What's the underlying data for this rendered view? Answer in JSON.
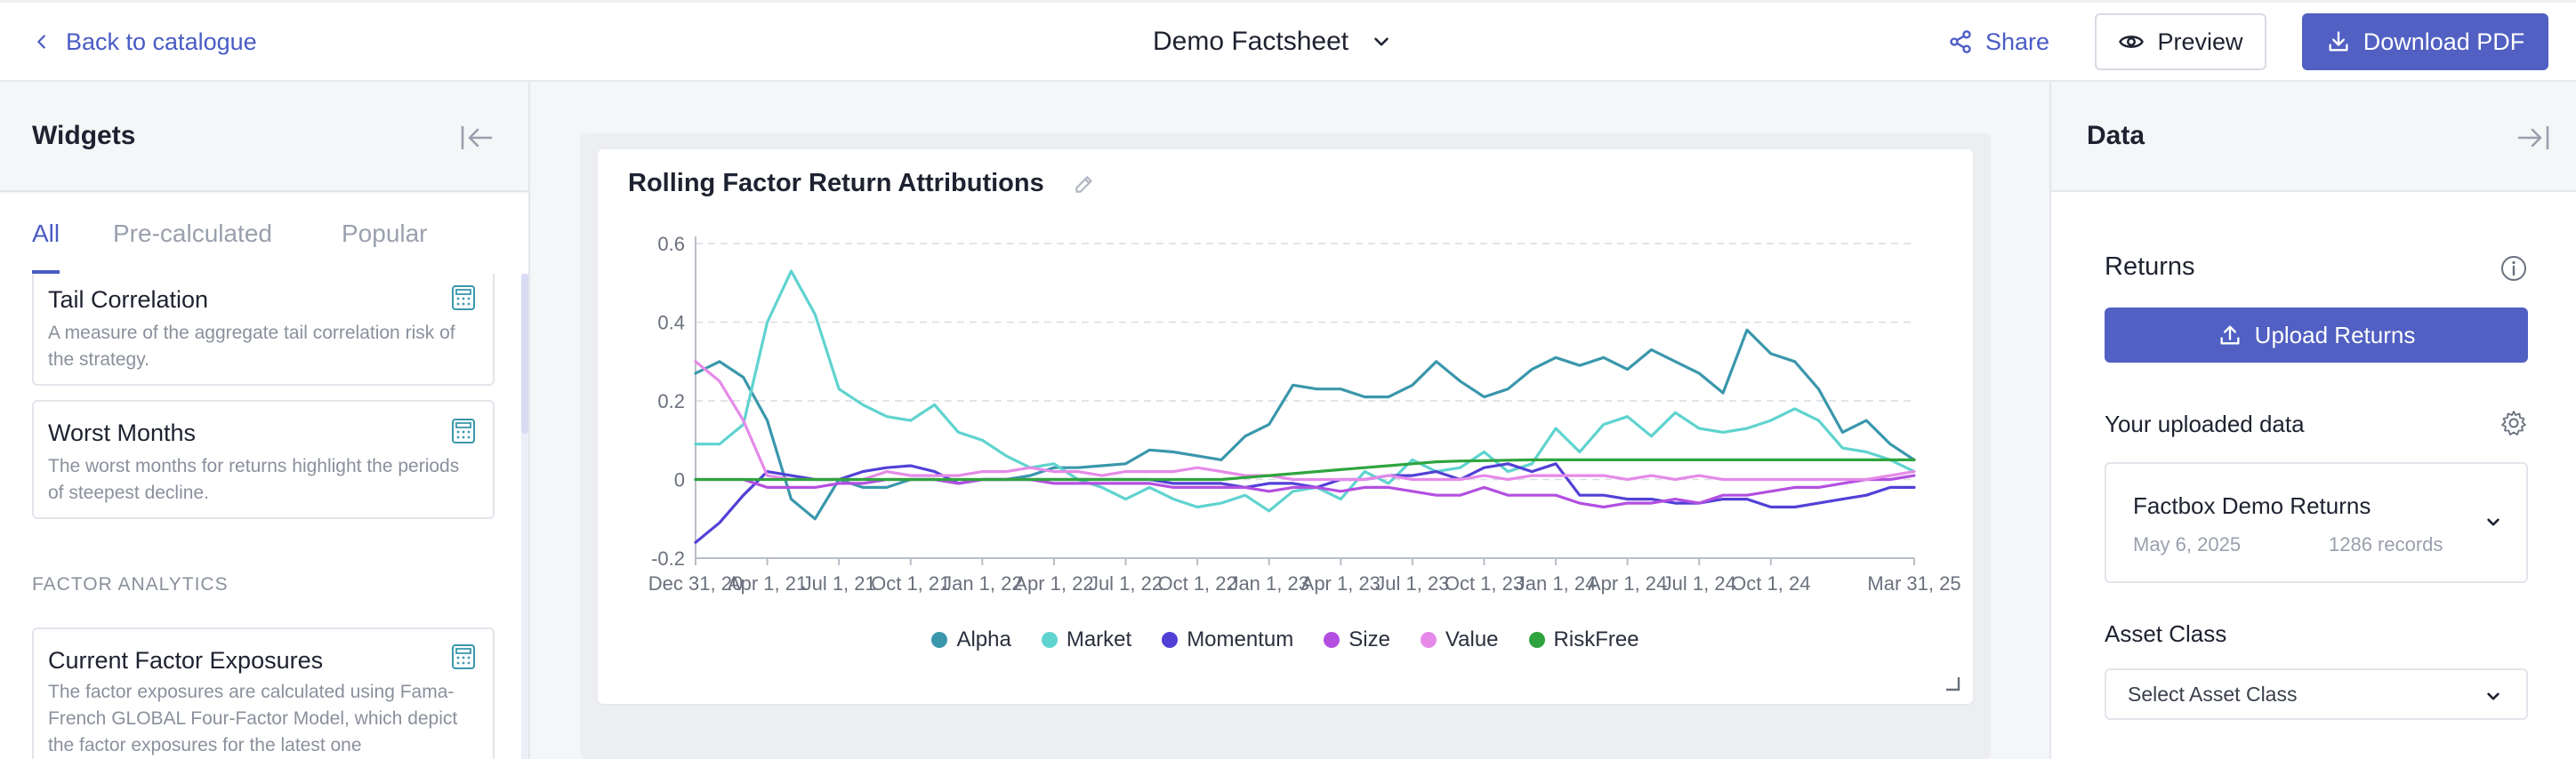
{
  "topbar": {
    "back_label": "Back to catalogue",
    "doc_title": "Demo Factsheet",
    "share_label": "Share",
    "preview_label": "Preview",
    "download_label": "Download PDF"
  },
  "widgets": {
    "title": "Widgets",
    "tabs": [
      {
        "label": "All",
        "active": true
      },
      {
        "label": "Pre-calculated",
        "active": false
      },
      {
        "label": "Popular",
        "active": false
      }
    ],
    "cards": [
      {
        "title": "Tail Correlation",
        "description": "A measure of the aggregate tail correlation risk of the strategy.",
        "icon": "calculator-icon"
      },
      {
        "title": "Worst Months",
        "description": "The worst months for returns highlight the periods of steepest decline.",
        "icon": "calculator-icon"
      }
    ],
    "section_label": "FACTOR ANALYTICS",
    "section_cards": [
      {
        "title": "Current Factor Exposures",
        "description": "The factor exposures are calculated using Fama-French GLOBAL Four-Factor Model, which depict the factor exposures for the latest one",
        "icon": "calculator-icon"
      }
    ]
  },
  "chart_card": {
    "title": "Rolling Factor Return Attributions"
  },
  "chart_data": {
    "type": "line",
    "title": "Rolling Factor Return Attributions",
    "xlabel": "",
    "ylabel": "",
    "ylim": [
      -0.2,
      0.6
    ],
    "yticks": [
      "0.6",
      "0.4",
      "0.2",
      "0",
      "-0.2"
    ],
    "ytick_values": [
      0.6,
      0.4,
      0.2,
      0,
      -0.2
    ],
    "xticks": [
      "Dec 31, 20",
      "Apr 1, 21",
      "Jul 1, 21",
      "Oct 1, 21",
      "Jan 1, 22",
      "Apr 1, 22",
      "Jul 1, 22",
      "Oct 1, 22",
      "Jan 1, 23",
      "Apr 1, 23",
      "Jul 1, 23",
      "Oct 1, 23",
      "Jan 1, 24",
      "Apr 1, 24",
      "Jul 1, 24",
      "Oct 1, 24",
      "Mar 31, 25"
    ],
    "xtick_months": [
      0,
      3,
      6,
      9,
      12,
      15,
      18,
      21,
      24,
      27,
      30,
      33,
      36,
      39,
      42,
      45,
      51
    ],
    "grid": true,
    "legend_position": "bottom",
    "x_months": [
      0,
      1,
      2,
      3,
      4,
      5,
      6,
      7,
      8,
      9,
      10,
      11,
      12,
      13,
      14,
      15,
      16,
      17,
      18,
      19,
      20,
      21,
      22,
      23,
      24,
      25,
      26,
      27,
      28,
      29,
      30,
      31,
      32,
      33,
      34,
      35,
      36,
      37,
      38,
      39,
      40,
      41,
      42,
      43,
      44,
      45,
      46,
      47,
      48,
      49,
      50,
      51
    ],
    "series": [
      {
        "name": "Alpha",
        "color": "#3a97ac",
        "values": [
          0.27,
          0.3,
          0.26,
          0.15,
          -0.05,
          -0.1,
          0.0,
          -0.02,
          -0.02,
          0.0,
          0.0,
          -0.01,
          0.0,
          0.0,
          0.01,
          0.03,
          0.03,
          0.035,
          0.04,
          0.075,
          0.07,
          0.06,
          0.05,
          0.11,
          0.14,
          0.24,
          0.23,
          0.23,
          0.21,
          0.21,
          0.24,
          0.3,
          0.25,
          0.21,
          0.23,
          0.28,
          0.31,
          0.29,
          0.31,
          0.28,
          0.33,
          0.3,
          0.27,
          0.22,
          0.38,
          0.32,
          0.3,
          0.23,
          0.12,
          0.15,
          0.09,
          0.05
        ]
      },
      {
        "name": "Market",
        "color": "#5fd3cf",
        "values": [
          0.09,
          0.09,
          0.14,
          0.4,
          0.53,
          0.42,
          0.23,
          0.19,
          0.16,
          0.15,
          0.19,
          0.12,
          0.1,
          0.06,
          0.03,
          0.04,
          0.0,
          -0.02,
          -0.05,
          -0.02,
          -0.05,
          -0.07,
          -0.06,
          -0.04,
          -0.08,
          -0.03,
          -0.02,
          -0.05,
          0.02,
          -0.01,
          0.05,
          0.02,
          0.03,
          0.07,
          0.02,
          0.04,
          0.13,
          0.07,
          0.14,
          0.16,
          0.11,
          0.17,
          0.13,
          0.12,
          0.13,
          0.15,
          0.18,
          0.15,
          0.08,
          0.07,
          0.05,
          0.02
        ]
      },
      {
        "name": "Momentum",
        "color": "#5240d6",
        "values": [
          -0.16,
          -0.11,
          -0.04,
          0.02,
          0.01,
          0.0,
          0.0,
          0.02,
          0.03,
          0.035,
          0.02,
          -0.01,
          0.0,
          0.0,
          0.0,
          0.0,
          0.0,
          0.0,
          0.0,
          0.0,
          -0.01,
          -0.01,
          -0.01,
          -0.02,
          -0.01,
          -0.01,
          -0.02,
          0.0,
          0.0,
          0.01,
          0.01,
          0.02,
          0.0,
          0.03,
          0.04,
          0.02,
          0.04,
          -0.04,
          -0.04,
          -0.05,
          -0.05,
          -0.06,
          -0.06,
          -0.05,
          -0.05,
          -0.07,
          -0.07,
          -0.06,
          -0.05,
          -0.04,
          -0.02,
          -0.02
        ]
      },
      {
        "name": "Size",
        "color": "#b34fe0",
        "values": [
          0.0,
          0.0,
          0.0,
          -0.02,
          -0.02,
          -0.02,
          -0.01,
          -0.01,
          0.0,
          0.0,
          0.0,
          -0.01,
          0.0,
          0.0,
          0.0,
          -0.01,
          -0.01,
          -0.01,
          -0.01,
          -0.01,
          -0.02,
          -0.02,
          -0.02,
          -0.02,
          -0.03,
          -0.02,
          -0.02,
          -0.03,
          -0.02,
          -0.02,
          -0.03,
          -0.04,
          -0.04,
          -0.02,
          -0.04,
          -0.04,
          -0.04,
          -0.06,
          -0.07,
          -0.06,
          -0.06,
          -0.05,
          -0.06,
          -0.04,
          -0.04,
          -0.03,
          -0.02,
          -0.02,
          -0.01,
          0.0,
          0.0,
          0.01
        ]
      },
      {
        "name": "Value",
        "color": "#e58ae8",
        "values": [
          0.3,
          0.25,
          0.15,
          0.01,
          0.0,
          0.0,
          0.0,
          0.0,
          0.02,
          0.01,
          0.01,
          0.01,
          0.02,
          0.02,
          0.03,
          0.02,
          0.02,
          0.01,
          0.02,
          0.02,
          0.02,
          0.03,
          0.02,
          0.01,
          0.01,
          0.0,
          0.0,
          0.0,
          0.0,
          0.01,
          0.0,
          0.0,
          0.0,
          0.01,
          0.0,
          0.01,
          0.01,
          0.01,
          0.01,
          0.0,
          0.01,
          0.0,
          0.01,
          0.0,
          0.0,
          0.0,
          0.0,
          0.0,
          0.0,
          0.0,
          0.01,
          0.02
        ]
      },
      {
        "name": "RiskFree",
        "color": "#2fa43e",
        "values": [
          0.0,
          0.0,
          0.0,
          0.0,
          0.0,
          0.0,
          0.0,
          0.0,
          0.0,
          0.0,
          0.0,
          0.0,
          0.0,
          0.0,
          0.0,
          0.0,
          0.0,
          0.0,
          0.0,
          0.0,
          0.0,
          0.0,
          0.0,
          0.005,
          0.01,
          0.015,
          0.02,
          0.025,
          0.03,
          0.035,
          0.04,
          0.045,
          0.047,
          0.048,
          0.049,
          0.05,
          0.05,
          0.05,
          0.05,
          0.05,
          0.05,
          0.05,
          0.05,
          0.05,
          0.05,
          0.05,
          0.05,
          0.05,
          0.05,
          0.05,
          0.05,
          0.05
        ]
      }
    ]
  },
  "data_panel": {
    "title": "Data",
    "returns_title": "Returns",
    "upload_label": "Upload Returns",
    "uploaded_title": "Your uploaded data",
    "dataset": {
      "name": "Factbox Demo Returns",
      "date": "May 6, 2025",
      "records": "1286 records"
    },
    "asset_class_title": "Asset Class",
    "asset_class_placeholder": "Select Asset Class"
  }
}
